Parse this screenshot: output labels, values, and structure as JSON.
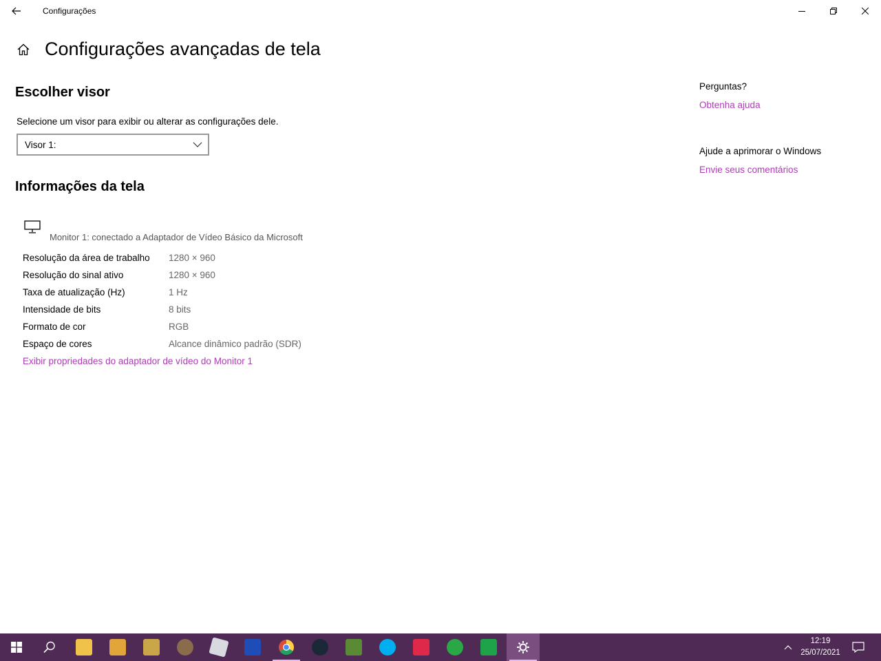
{
  "window": {
    "title": "Configurações"
  },
  "header": {
    "title": "Configurações avançadas de tela"
  },
  "choose_display": {
    "heading": "Escolher visor",
    "caption": "Selecione um visor para exibir ou alterar as configurações dele.",
    "selected": "Visor 1:"
  },
  "display_info": {
    "heading": "Informações da tela",
    "monitor_caption": "Monitor 1: conectado a Adaptador de Vídeo Básico da Microsoft",
    "rows": [
      {
        "label": "Resolução da área de trabalho",
        "value": "1280 × 960"
      },
      {
        "label": "Resolução do sinal ativo",
        "value": "1280 × 960"
      },
      {
        "label": "Taxa de atualização (Hz)",
        "value": "1 Hz"
      },
      {
        "label": "Intensidade de bits",
        "value": "8 bits"
      },
      {
        "label": "Formato de cor",
        "value": "RGB"
      },
      {
        "label": "Espaço de cores",
        "value": "Alcance dinâmico padrão (SDR)"
      }
    ],
    "adapter_link": "Exibir propriedades do adaptador de vídeo do Monitor 1"
  },
  "side": {
    "questions_label": "Perguntas?",
    "help_link": "Obtenha ajuda",
    "improve_label": "Ajude a aprimorar o Windows",
    "feedback_link": "Envie seus comentários"
  },
  "taskbar": {
    "time": "12:19",
    "date": "25/07/2021",
    "apps": [
      {
        "name": "file-explorer-icon",
        "color": "#f0c24a"
      },
      {
        "name": "game-app-icon",
        "color": "#e2a53a"
      },
      {
        "name": "league-client-icon",
        "color": "#c9a648"
      },
      {
        "name": "avatar-app-icon",
        "color": "#8a6b4c"
      },
      {
        "name": "roblox-icon",
        "color": "#d9d9e0"
      },
      {
        "name": "z-app-icon",
        "color": "#1e4db7"
      },
      {
        "name": "chrome-icon",
        "color": "#dd4b39"
      },
      {
        "name": "steam-icon",
        "color": "#1b2838"
      },
      {
        "name": "minecraft-icon",
        "color": "#5b8a34"
      },
      {
        "name": "skype-icon",
        "color": "#00aff0"
      },
      {
        "name": "red-app-icon",
        "color": "#e0284a"
      },
      {
        "name": "internet-download-icon",
        "color": "#2aa845"
      },
      {
        "name": "green-app-icon",
        "color": "#1fa34a"
      }
    ]
  }
}
